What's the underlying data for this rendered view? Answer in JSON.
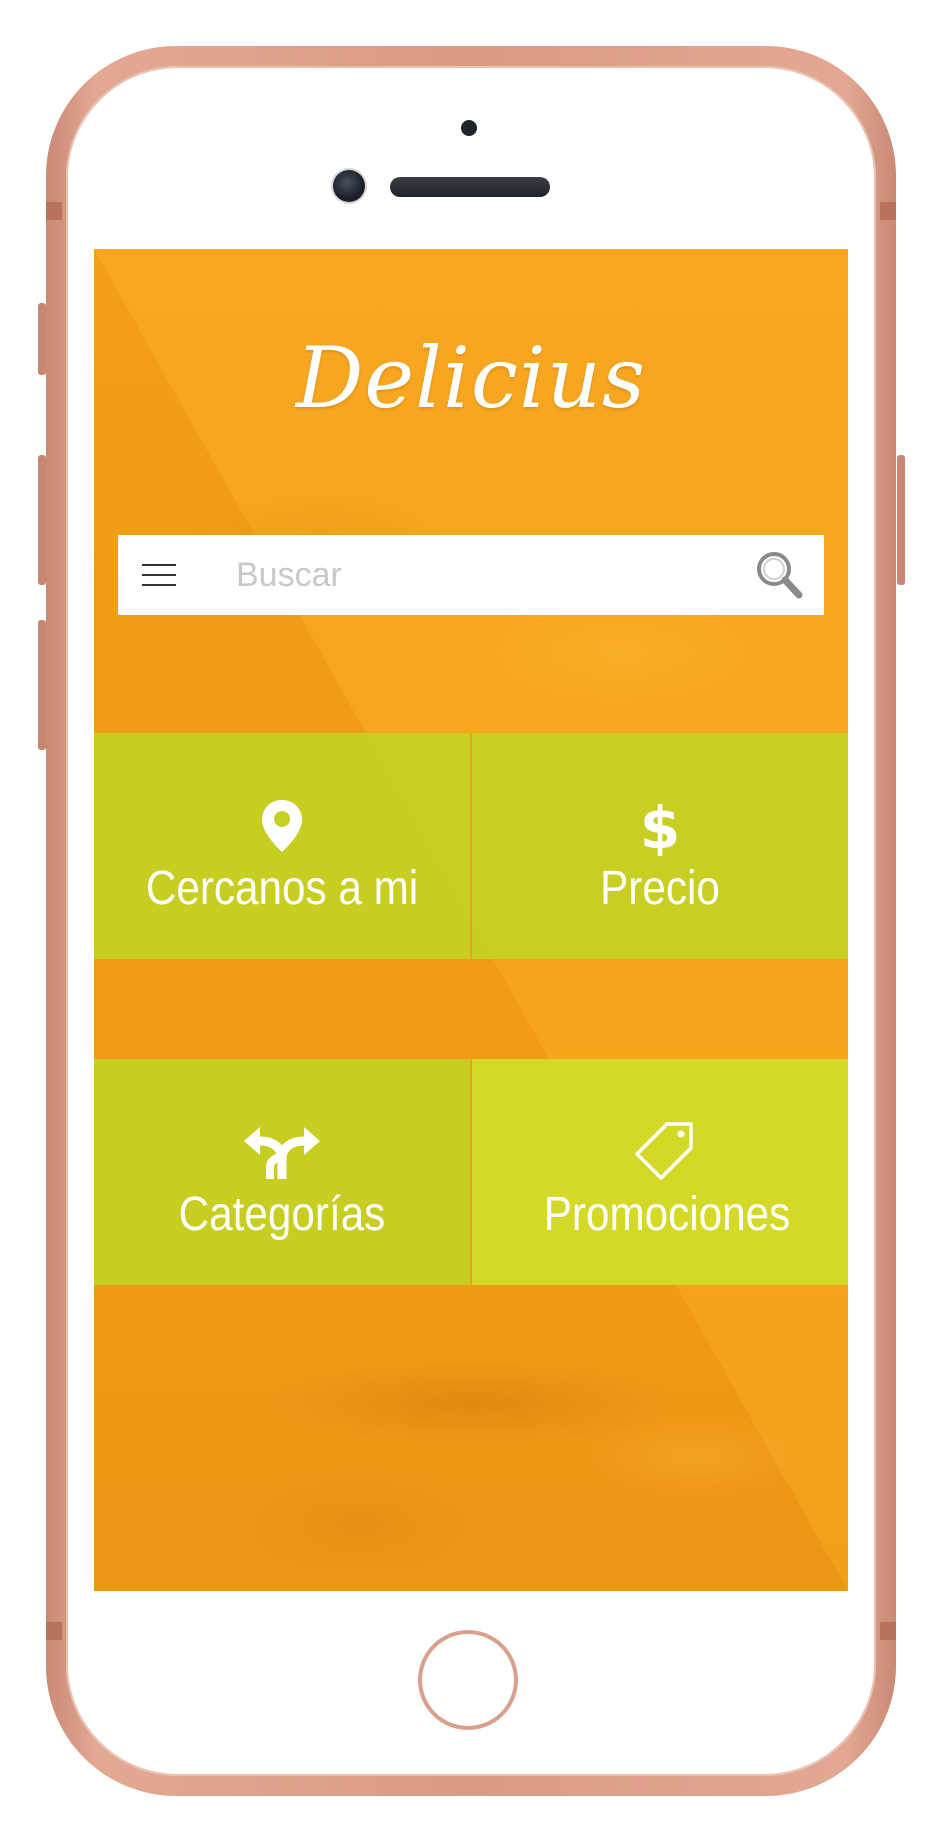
{
  "app": {
    "logo_text": "Delicius"
  },
  "search": {
    "placeholder": "Buscar",
    "value": ""
  },
  "tiles": [
    {
      "label": "Cercanos a mi",
      "icon": "location-pin-icon"
    },
    {
      "label": "Precio",
      "icon": "dollar-icon"
    },
    {
      "label": "Categorías",
      "icon": "fork-arrows-icon"
    },
    {
      "label": "Promociones",
      "icon": "price-tag-icon"
    }
  ],
  "colors": {
    "background_orange": "#f5a01a",
    "tile_green": "#c8d224",
    "phone_frame": "#d99a82",
    "text_white": "#ffffff"
  }
}
